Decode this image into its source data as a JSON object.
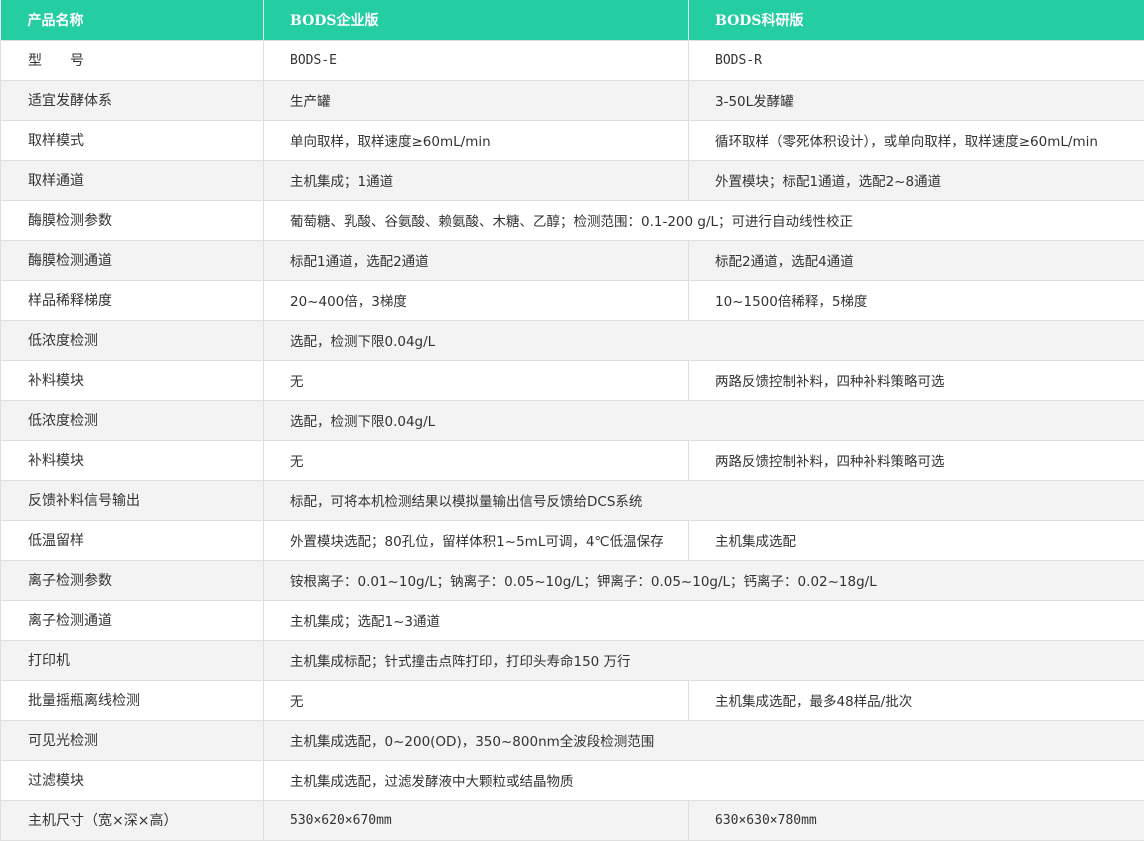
{
  "header": {
    "col1": "产品名称",
    "col2": "BODS企业版",
    "col3": "BODS科研版"
  },
  "rows": [
    {
      "name": "型　　号",
      "e": "BODS-E",
      "r": "BODS-R"
    },
    {
      "name": "适宜发酵体系",
      "e": "生产罐",
      "r": "3-50L发酵罐"
    },
    {
      "name": "取样模式",
      "e": "单向取样，取样速度≥60mL/min",
      "r": "循环取样（零死体积设计），或单向取样，取样速度≥60mL/min"
    },
    {
      "name": "取样通道",
      "e": "主机集成；1通道",
      "r": "外置模块；标配1通道，选配2~8通道"
    },
    {
      "name": "酶膜检测参数",
      "span": "葡萄糖、乳酸、谷氨酸、赖氨酸、木糖、乙醇；检测范围：0.1-200 g/L；可进行自动线性校正"
    },
    {
      "name": "酶膜检测通道",
      "e": "标配1通道，选配2通道",
      "r": "标配2通道，选配4通道"
    },
    {
      "name": "样品稀释梯度",
      "e": "20~400倍，3梯度",
      "r": "10~1500倍稀释，5梯度"
    },
    {
      "name": "低浓度检测",
      "span": "选配，检测下限0.04g/L"
    },
    {
      "name": "补料模块",
      "e": "无",
      "r": "两路反馈控制补料，四种补料策略可选"
    },
    {
      "name": "低浓度检测",
      "span": "选配，检测下限0.04g/L"
    },
    {
      "name": "补料模块",
      "e": "无",
      "r": "两路反馈控制补料，四种补料策略可选"
    },
    {
      "name": "反馈补料信号输出",
      "span": "标配，可将本机检测结果以模拟量输出信号反馈给DCS系统"
    },
    {
      "name": "低温留样",
      "e": "外置模块选配；80孔位，留样体积1~5mL可调，4℃低温保存",
      "r": "主机集成选配"
    },
    {
      "name": "离子检测参数",
      "span": "铵根离子：0.01~10g/L；钠离子：0.05~10g/L；钾离子：0.05~10g/L；钙离子：0.02~18g/L"
    },
    {
      "name": "离子检测通道",
      "span": "主机集成；选配1~3通道"
    },
    {
      "name": "打印机",
      "span": "主机集成标配；针式撞击点阵打印，打印头寿命150 万行"
    },
    {
      "name": "批量摇瓶离线检测",
      "e": "无",
      "r": "主机集成选配，最多48样品/批次"
    },
    {
      "name": "可见光检测",
      "span": "主机集成选配，0~200(OD)，350~800nm全波段检测范围"
    },
    {
      "name": "过滤模块",
      "span": "主机集成选配，过滤发酵液中大颗粒或结晶物质"
    },
    {
      "name": "主机尺寸（宽×深×高）",
      "e": "530×620×670mm",
      "r": "630×630×780mm"
    }
  ],
  "colors": {
    "header_bg": "#24cda2",
    "row_alt_bg": "#f3f3f3",
    "border": "#dedede"
  }
}
